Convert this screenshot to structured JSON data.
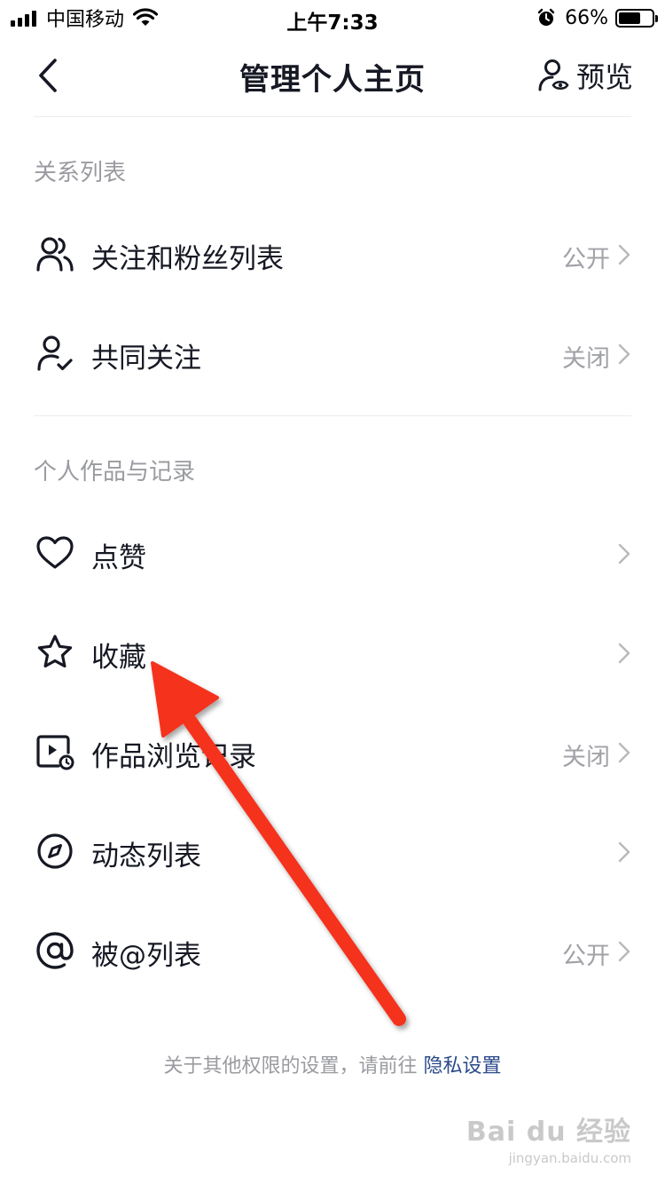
{
  "status_bar": {
    "carrier": "中国移动",
    "time": "上午7:33",
    "battery": "66%",
    "battery_level": 0.66
  },
  "nav": {
    "title": "管理个人主页",
    "preview_label": "预览"
  },
  "sections": [
    {
      "header": "关系列表",
      "items": [
        {
          "label": "关注和粉丝列表",
          "value": "公开",
          "icon": "users-icon"
        },
        {
          "label": "共同关注",
          "value": "关闭",
          "icon": "user-check-icon"
        }
      ]
    },
    {
      "header": "个人作品与记录",
      "items": [
        {
          "label": "点赞",
          "value": "",
          "icon": "heart-icon"
        },
        {
          "label": "收藏",
          "value": "",
          "icon": "star-icon"
        },
        {
          "label": "作品浏览记录",
          "value": "关闭",
          "icon": "video-history-icon"
        },
        {
          "label": "动态列表",
          "value": "",
          "icon": "compass-icon"
        },
        {
          "label": "被@列表",
          "value": "公开",
          "icon": "at-icon"
        }
      ]
    }
  ],
  "footer": {
    "note": "关于其他权限的设置，请前往 ",
    "link": "隐私设置"
  },
  "watermark": {
    "main": "Bai du 经验",
    "sub": "jingyan.baidu.com"
  },
  "colors": {
    "arrow": "#f5321f",
    "link": "#2b4a8a",
    "secondary_text": "#9a9ba0"
  }
}
